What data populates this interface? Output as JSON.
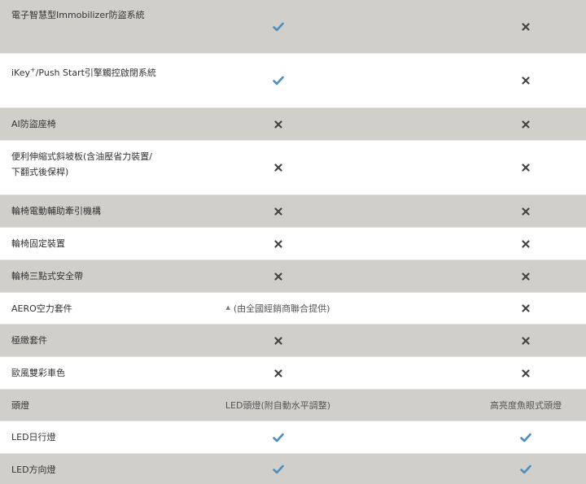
{
  "colors": {
    "shade_row": "#d1cfc9",
    "plain_row": "#ffffff",
    "check": "#4a8fbf",
    "cross": "#444444"
  },
  "rows": [
    {
      "feature": "電子智慧型Immobilizer防盜系統",
      "col1": {
        "type": "check"
      },
      "col2": {
        "type": "cross"
      }
    },
    {
      "feature_prefix": "iKey",
      "feature_sup": "+",
      "feature": "/Push Start引擎觸控啟閉系統",
      "col1": {
        "type": "check"
      },
      "col2": {
        "type": "cross"
      }
    },
    {
      "feature": "AI防盜座椅",
      "col1": {
        "type": "cross"
      },
      "col2": {
        "type": "cross"
      }
    },
    {
      "feature": "便利伸縮式斜坡板(含油壓省力裝置/下翻式後保桿)",
      "col1": {
        "type": "cross"
      },
      "col2": {
        "type": "cross"
      }
    },
    {
      "feature": "輪椅電動輔助牽引機構",
      "col1": {
        "type": "cross"
      },
      "col2": {
        "type": "cross"
      }
    },
    {
      "feature": "輪椅固定裝置",
      "col1": {
        "type": "cross"
      },
      "col2": {
        "type": "cross"
      }
    },
    {
      "feature": "輪椅三點式安全帶",
      "col1": {
        "type": "cross"
      },
      "col2": {
        "type": "cross"
      }
    },
    {
      "feature": "AERO空力套件",
      "col1": {
        "type": "text",
        "symbol": "▲",
        "text": "(由全國經銷商聯合提供)"
      },
      "col2": {
        "type": "cross"
      }
    },
    {
      "feature": "極緻套件",
      "col1": {
        "type": "cross"
      },
      "col2": {
        "type": "cross"
      }
    },
    {
      "feature": "歐風雙彩車色",
      "col1": {
        "type": "cross"
      },
      "col2": {
        "type": "cross"
      }
    },
    {
      "feature": "頭燈",
      "col1": {
        "type": "text",
        "text": "LED頭燈(附自動水平調整)"
      },
      "col2": {
        "type": "text",
        "text": "高亮度魚眼式頭燈"
      }
    },
    {
      "feature": "LED日行燈",
      "col1": {
        "type": "check"
      },
      "col2": {
        "type": "check"
      }
    },
    {
      "feature": "LED方向燈",
      "col1": {
        "type": "check"
      },
      "col2": {
        "type": "check"
      }
    }
  ]
}
